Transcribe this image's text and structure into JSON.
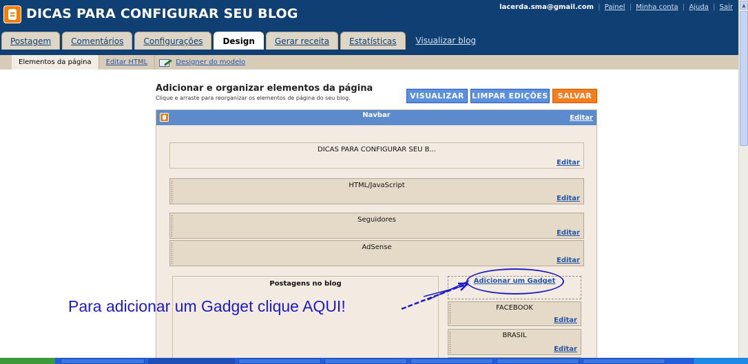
{
  "header": {
    "title": "DICAS PARA CONFIGURAR SEU BLOG",
    "email": "lacerda.sma@gmail.com",
    "links": [
      "Painel",
      "Minha conta",
      "Ajuda",
      "Sair"
    ]
  },
  "tabs": [
    "Postagem",
    "Comentários",
    "Configurações",
    "Design",
    "Gerar receita",
    "Estatísticas"
  ],
  "tabs_active": "Design",
  "view_blog": "Visualizar blog",
  "subnav": [
    "Elementos da página",
    "Editar HTML",
    "Designer do modelo"
  ],
  "main": {
    "heading": "Adicionar e organizar elementos da página",
    "subheading": "Clique e arraste para reorganizar os elementos de página do seu blog.",
    "buttons": {
      "view": "VISUALIZAR",
      "clear": "LIMPAR EDIÇÕES",
      "save": "SALVAR"
    }
  },
  "layout": {
    "navbar_label": "Navbar",
    "navbar_edit": "Editar",
    "edit_label": "Editar",
    "header_gadget": "DICAS PARA CONFIGURAR SEU B...",
    "gadgets": [
      "HTML/JavaScript",
      "Seguidores",
      "AdSense"
    ],
    "posts_label": "Postagens no blog",
    "add_gadget": "Adicionar um Gadget",
    "sidebar_gadgets": [
      "FACEBOOK",
      "BRASIL"
    ]
  },
  "annotation": "Para adicionar um Gadget clique AQUI!",
  "colors": {
    "header_bg": "#0f3f73",
    "navbar_bg": "#5b8acd",
    "save_btn": "#f57d1e",
    "blue_btn": "#5b8fe0",
    "annotation": "#1a1ac8"
  }
}
